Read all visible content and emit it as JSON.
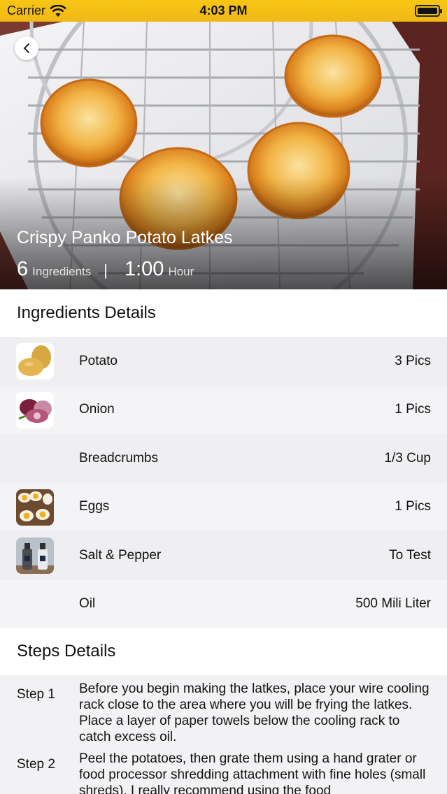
{
  "status_bar": {
    "carrier": "Carrier",
    "time": "4:03 PM"
  },
  "recipe": {
    "title": "Crispy Panko Potato Latkes",
    "ingredients_count": "6",
    "ingredients_label": "Ingredients",
    "separator": "|",
    "duration": "1:00",
    "duration_label": "Hour"
  },
  "ingredients_section": {
    "title": "Ingredients Details"
  },
  "ingredients": [
    {
      "name": "Potato",
      "qty": "3 Pics",
      "icon": "potato-icon"
    },
    {
      "name": "Onion",
      "qty": "1 Pics",
      "icon": "onion-icon"
    },
    {
      "name": "Breadcrumbs",
      "qty": "1/3 Cup",
      "icon": ""
    },
    {
      "name": "Eggs",
      "qty": "1 Pics",
      "icon": "eggs-icon"
    },
    {
      "name": "Salt & Pepper",
      "qty": "To Test",
      "icon": "salt-pepper-icon"
    },
    {
      "name": "Oil",
      "qty": "500 Mili Liter",
      "icon": ""
    }
  ],
  "steps_section": {
    "title": "Steps Details"
  },
  "steps": [
    {
      "label": "Step 1",
      "text": "Before you begin making the latkes, place your wire cooling rack close to the area where you will be frying the latkes. Place a layer of paper towels below the cooling rack to catch excess oil."
    },
    {
      "label": "Step 2",
      "text": "Peel the potatoes, then grate them using a hand grater or food processor shredding attachment with fine holes (small shreds). I really recommend using the food"
    }
  ],
  "colors": {
    "status_bar": "#f6c317",
    "latke": "#e59a2a",
    "background": "#f2f2f4"
  }
}
